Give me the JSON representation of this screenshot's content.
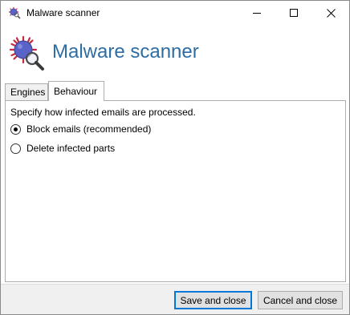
{
  "window": {
    "title": "Malware scanner"
  },
  "header": {
    "title": "Malware scanner"
  },
  "tabs": [
    {
      "label": "Engines",
      "selected": false
    },
    {
      "label": "Behaviour",
      "selected": true
    }
  ],
  "behaviour": {
    "description": "Specify how infected emails are processed.",
    "options": [
      {
        "label": "Block emails (recommended)",
        "checked": true
      },
      {
        "label": "Delete infected parts",
        "checked": false
      }
    ]
  },
  "footer": {
    "save_label": "Save and close",
    "cancel_label": "Cancel and close"
  },
  "icons": {
    "app": "virus-magnifier-icon",
    "minimize": "minimize-icon",
    "maximize": "maximize-icon",
    "close": "close-icon"
  },
  "colors": {
    "header_title": "#2e6da4",
    "virus_body": "#5a64c8",
    "virus_spikes": "#c8283c",
    "footer_bg": "#f0f0f0",
    "default_button_border": "#0078d7"
  }
}
